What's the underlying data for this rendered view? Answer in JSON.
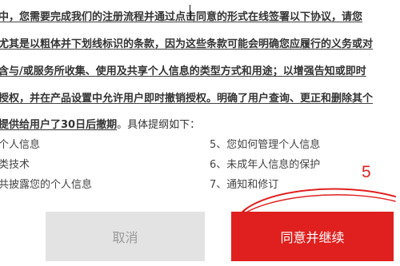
{
  "agreement": {
    "lines": [
      "中，您需要完成我们的注册流程并通过点击同意的形式在线签署以下协议，请您",
      "尤其是以粗体并下划线标识的条款，因为这些条款可能会明确您应履行的义务或对",
      "含与/或服务所收集、使用及共享个人信息的类型方式和用途；以增强告知或即时",
      "授权，并在产品设置中允许用户即时撤销授权。明确了用户查询、更正和删除其个"
    ],
    "last_line_underlined": "提供给用户了30日后撤期",
    "last_line_normal": "。具体提纲如下："
  },
  "toc": {
    "left": [
      "个人信息",
      "类技术",
      "共披露您的个人信息"
    ],
    "right": [
      "5、您如何管理个人信息",
      "6、未成年人信息的保护",
      "7、通知和修订"
    ]
  },
  "buttons": {
    "cancel": "取消",
    "agree": "同意并继续"
  },
  "annotation": {
    "step_number": "5",
    "color": "#e02020"
  },
  "colors": {
    "agree_button": "#e0201f",
    "cancel_button": "#e3e3e3"
  }
}
